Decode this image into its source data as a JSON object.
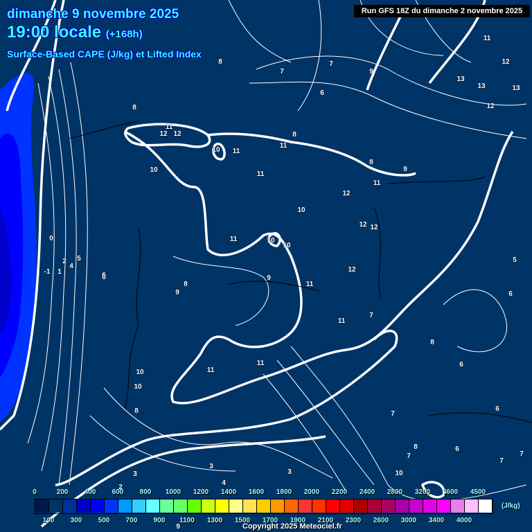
{
  "header": {
    "date": "dimanche 9 novembre 2025",
    "time": "19:00 locale",
    "lead": "(+168h)",
    "parameter": "Surface-Based CAPE (J/kg) et Lifted Index",
    "run": "Run GFS 18Z du dimanche 2 novembre 2025"
  },
  "legend": {
    "unit": "(J/kg)",
    "top_labels": [
      "0",
      "200",
      "400",
      "600",
      "800",
      "1000",
      "1200",
      "1400",
      "1600",
      "1800",
      "2000",
      "2200",
      "2400",
      "2800",
      "3200",
      "3600",
      "4500"
    ],
    "bottom_labels": [
      "100",
      "300",
      "500",
      "700",
      "900",
      "1100",
      "1300",
      "1500",
      "1700",
      "1900",
      "2100",
      "2300",
      "2600",
      "3000",
      "3400",
      "4000"
    ],
    "colors": [
      "#00184a",
      "#003366",
      "#003399",
      "#0000cc",
      "#0000ff",
      "#0033ff",
      "#0099ff",
      "#33ccff",
      "#66ffff",
      "#66ff99",
      "#66ff66",
      "#66ff00",
      "#ccff11",
      "#ffff00",
      "#ffff88",
      "#ffe44d",
      "#ffcc00",
      "#ff9900",
      "#ff6600",
      "#ff3333",
      "#ff3300",
      "#ff0000",
      "#e00000",
      "#aa0000",
      "#aa0033",
      "#aa0066",
      "#aa00aa",
      "#cc00cc",
      "#e600e6",
      "#ff00ff",
      "#e680e6",
      "#ffc0ff",
      "#ffffff"
    ]
  },
  "contour_labels": [
    "8",
    "7",
    "7",
    "9",
    "6",
    "11",
    "12",
    "13",
    "13",
    "13",
    "12",
    "8",
    "11",
    "12",
    "12",
    "10",
    "11",
    "11",
    "8",
    "10",
    "9",
    "8",
    "11",
    "11",
    "12",
    "10",
    "12",
    "12",
    "10",
    "10",
    "11",
    "0",
    "2",
    "5",
    "-1",
    "1",
    "4",
    "6",
    "12",
    "11",
    "9",
    "8",
    "9",
    "11",
    "11",
    "7",
    "5",
    "6",
    "8",
    "6",
    "11",
    "10",
    "10",
    "8",
    "7",
    "6",
    "8",
    "7",
    "6",
    "7",
    "7",
    "3",
    "3",
    "2",
    "4",
    "3",
    "10",
    "9",
    "6"
  ],
  "copyright": "Copyright 2025 Meteociel.fr"
}
